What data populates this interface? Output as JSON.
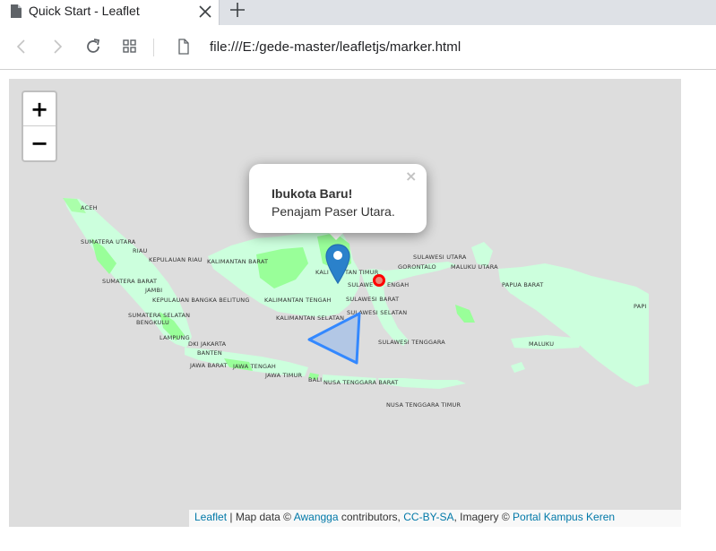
{
  "browser": {
    "tab_title": "Quick Start - Leaflet",
    "url": "file:///E:/gede-master/leafletjs/marker.html",
    "icons": [
      "file-icon",
      "close-icon",
      "plus-icon",
      "back-icon",
      "forward-icon",
      "reload-icon",
      "apps-icon",
      "page-icon"
    ]
  },
  "map": {
    "zoom_in": "+",
    "zoom_out": "−",
    "popup": {
      "title": "Ibukota Baru!",
      "body": "Penajam Paser Utara.",
      "close": "×"
    },
    "labels": {
      "aceh": "ACEH",
      "sumut": "SUMATERA UTARA",
      "riau": "RIAU",
      "kepriau": "KEPULAUAN RIAU",
      "kalbar": "KALIMANTAN BARAT",
      "sumbar": "SUMATERA BARAT",
      "jambi": "JAMBI",
      "babel": "KEPULAUAN BANGKA BELITUNG",
      "sumsel": "SUMATERA SELATAN",
      "bengkulu": "BENGKULU",
      "lampung": "LAMPUNG",
      "jakarta": "DKI JAKARTA",
      "banten": "BANTEN",
      "jabar": "JAWA BARAT",
      "jateng": "JAWA TENGAH",
      "jatim": "JAWA TIMUR",
      "bali": "BALI",
      "ntb": "NUSA TENGGARA BARAT",
      "ntt": "NUSA TENGGARA TIMUR",
      "kalteng": "KALIMANTAN TENGAH",
      "kalsel": "KALIMANTAN SELATAN",
      "kaltim_a": "KALI",
      "kaltim_b": "TAN TIMUR",
      "sulteng_a": "SULAWE",
      "sulteng_b": "ENGAH",
      "sulbar": "SULAWESI BARAT",
      "sulsel": "SULAWESI SELATAN",
      "sultra": "SULAWESI TENGGARA",
      "sulut": "SULAWESI UTARA",
      "gorontalo": "GORONTALO",
      "malut": "MALUKU UTARA",
      "maluku": "MALUKU",
      "papbar": "PAPUA BARAT",
      "papua": "PAPI"
    },
    "attribution": {
      "leaflet": "Leaflet",
      "sep1": " | Map data © ",
      "awangga": "Awangga",
      "contrib": " contributors, ",
      "license": "CC-BY-SA",
      "imagery": ", Imagery © ",
      "portal": "Portal Kampus Keren"
    },
    "colors": {
      "background": "#dddddd",
      "land_light": "#ccffdd",
      "land_mid": "#99ff99",
      "polygon_stroke": "#3388ff",
      "circle": "#ff0000",
      "marker": "#2a81cb",
      "link": "#0078a8"
    }
  }
}
